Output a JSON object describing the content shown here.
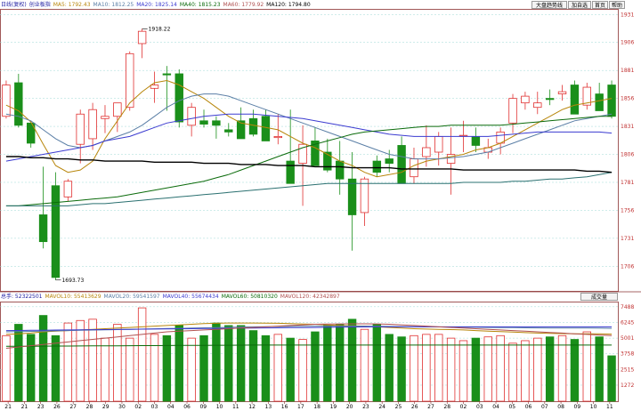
{
  "price_legend": [
    {
      "text": "日线(复权)",
      "color": "#1a1aa0"
    },
    {
      "text": "创业板指",
      "color": "#1a1aa0"
    },
    {
      "text": "MA5: 1792.43",
      "color": "#b8860b"
    },
    {
      "text": "MA10: 1812.25",
      "color": "#5b7fa6"
    },
    {
      "text": "MA20: 1825.14",
      "color": "#3b3bd0"
    },
    {
      "text": "MA40: 1815.23",
      "color": "#0b6b0b"
    },
    {
      "text": "MA60: 1779.92",
      "color": "#b05050"
    },
    {
      "text": "MA120: 1794.80",
      "color": "#000000"
    }
  ],
  "volume_legend": [
    {
      "text": "总手: 52322501",
      "color": "#1a1aa0"
    },
    {
      "text": "MAVOL10: 55413629",
      "color": "#b8860b"
    },
    {
      "text": "MAVOL20: 59541597",
      "color": "#5b7fa6"
    },
    {
      "text": "MAVOL40: 55674434",
      "color": "#3b3bd0"
    },
    {
      "text": "MAVOL60: 50810320",
      "color": "#0b6b0b"
    },
    {
      "text": "MAVOL120: 42342897",
      "color": "#b05050"
    }
  ],
  "toolbar": {
    "big_cap": "大盘趋势线",
    "add": "加自选",
    "home": "首页",
    "help": "帮助"
  },
  "volume_selector": "成交量",
  "chart_data": [
    {
      "type": "candlestick",
      "x": [
        "21",
        "21",
        "22",
        "23",
        "24",
        "26",
        "27",
        "28",
        "28",
        "29",
        "30",
        "30",
        "02",
        "03",
        "04",
        "05",
        "06",
        "07",
        "08",
        "09",
        "10",
        "11",
        "12",
        "13",
        "14",
        "15",
        "16",
        "17",
        "18",
        "19",
        "20",
        "21",
        "22",
        "23",
        "24",
        "25",
        "26",
        "27",
        "28",
        "01",
        "02",
        "03",
        "04",
        "05",
        "06",
        "07",
        "08",
        "09",
        "10",
        "11"
      ],
      "x_ticks": [
        "21",
        "21",
        "23",
        "26",
        "27",
        "28",
        "29",
        "30",
        "02",
        "03",
        "04",
        "06",
        "09",
        "10",
        "11",
        "12",
        "13",
        "16",
        "17",
        "18",
        "19",
        "20",
        "23",
        "24",
        "25",
        "26",
        "27",
        "28",
        "02",
        "03",
        "04",
        "05",
        "06",
        "07",
        "08",
        "09",
        "10",
        "11"
      ],
      "ohlc": [
        [
          1840,
          1872,
          1838,
          1868
        ],
        [
          1870,
          1878,
          1830,
          1832
        ],
        [
          1834,
          1836,
          1812,
          1816
        ],
        [
          1752,
          1795,
          1722,
          1728
        ],
        [
          1778,
          1790,
          1693.73,
          1696
        ],
        [
          1768,
          1784,
          1764,
          1782
        ],
        [
          1815,
          1846,
          1798,
          1842
        ],
        [
          1820,
          1852,
          1810,
          1846
        ],
        [
          1838,
          1850,
          1825,
          1840
        ],
        [
          1840,
          1850,
          1826,
          1852
        ],
        [
          1848,
          1898,
          1845,
          1896
        ],
        [
          1905,
          1918.22,
          1892,
          1916
        ],
        [
          1865,
          1880,
          1852,
          1868
        ],
        [
          1878,
          1885,
          1845,
          1877
        ],
        [
          1878,
          1882,
          1830,
          1835
        ],
        [
          1832,
          1852,
          1822,
          1848
        ],
        [
          1836,
          1846,
          1830,
          1833
        ],
        [
          1836,
          1840,
          1820,
          1832
        ],
        [
          1828,
          1834,
          1822,
          1826
        ],
        [
          1836,
          1848,
          1828,
          1820
        ],
        [
          1838,
          1846,
          1822,
          1824
        ],
        [
          1840,
          1846,
          1832,
          1818
        ],
        [
          1821,
          1842,
          1815,
          1822
        ],
        [
          1800,
          1846,
          1785,
          1780
        ],
        [
          1798,
          1832,
          1760,
          1815
        ],
        [
          1818,
          1830,
          1800,
          1796
        ],
        [
          1808,
          1820,
          1790,
          1792
        ],
        [
          1800,
          1818,
          1770,
          1784
        ],
        [
          1784,
          1808,
          1720,
          1752
        ],
        [
          1754,
          1786,
          1742,
          1784
        ],
        [
          1800,
          1805,
          1786,
          1790
        ],
        [
          1802,
          1810,
          1790,
          1798
        ],
        [
          1814,
          1822,
          1796,
          1780
        ],
        [
          1786,
          1812,
          1780,
          1802
        ],
        [
          1804,
          1832,
          1795,
          1812
        ],
        [
          1808,
          1826,
          1796,
          1822
        ],
        [
          1798,
          1830,
          1770,
          1806
        ],
        [
          1823,
          1836,
          1808,
          1823
        ],
        [
          1822,
          1830,
          1808,
          1814
        ],
        [
          1808,
          1820,
          1802,
          1812
        ],
        [
          1816,
          1830,
          1806,
          1826
        ],
        [
          1834,
          1860,
          1825,
          1856
        ],
        [
          1852,
          1862,
          1846,
          1858
        ],
        [
          1848,
          1862,
          1842,
          1852
        ],
        [
          1856,
          1864,
          1850,
          1855
        ],
        [
          1860,
          1868,
          1854,
          1862
        ],
        [
          1868,
          1872,
          1848,
          1842
        ],
        [
          1850,
          1870,
          1846,
          1866
        ],
        [
          1860,
          1870,
          1848,
          1845
        ],
        [
          1868,
          1872,
          1838,
          1840
        ]
      ],
      "annotations": [
        {
          "text": "1918.22",
          "value": 1918.22
        },
        {
          "text": "1693.73",
          "value": 1693.73
        }
      ],
      "y_ticks": [
        1931,
        1906,
        1881,
        1856,
        1831,
        1806,
        1781,
        1756,
        1731,
        1706
      ],
      "ylim": [
        1684,
        1936
      ],
      "moving_averages": [
        {
          "name": "MA5",
          "color": "#b8860b",
          "values": [
            1850,
            1845,
            1835,
            1815,
            1796,
            1790,
            1792,
            1800,
            1820,
            1836,
            1852,
            1862,
            1870,
            1872,
            1868,
            1862,
            1856,
            1848,
            1840,
            1834,
            1832,
            1830,
            1828,
            1822,
            1816,
            1812,
            1806,
            1800,
            1796,
            1790,
            1786,
            1788,
            1790,
            1796,
            1800,
            1802,
            1804,
            1806,
            1810,
            1812,
            1816,
            1822,
            1828,
            1834,
            1840,
            1846,
            1850,
            1852,
            1854,
            1856
          ]
        },
        {
          "name": "MA10",
          "color": "#5b7fa6",
          "values": [
            1842,
            1840,
            1836,
            1828,
            1820,
            1814,
            1812,
            1814,
            1818,
            1822,
            1826,
            1832,
            1840,
            1848,
            1854,
            1858,
            1860,
            1860,
            1858,
            1854,
            1850,
            1846,
            1842,
            1838,
            1834,
            1830,
            1826,
            1822,
            1818,
            1814,
            1810,
            1806,
            1804,
            1802,
            1802,
            1802,
            1803,
            1804,
            1806,
            1808,
            1812,
            1816,
            1820,
            1824,
            1828,
            1832,
            1836,
            1838,
            1840,
            1842
          ]
        },
        {
          "name": "MA20",
          "color": "#3b3bd0",
          "values": [
            1800,
            1802,
            1804,
            1806,
            1808,
            1810,
            1812,
            1814,
            1818,
            1820,
            1822,
            1826,
            1830,
            1834,
            1836,
            1838,
            1840,
            1841,
            1842,
            1842,
            1842,
            1841,
            1840,
            1839,
            1838,
            1836,
            1834,
            1832,
            1830,
            1828,
            1826,
            1824,
            1823,
            1822,
            1822,
            1822,
            1822,
            1822,
            1822,
            1822,
            1823,
            1824,
            1825,
            1826,
            1826,
            1826,
            1826,
            1826,
            1826,
            1825
          ]
        },
        {
          "name": "MA40",
          "color": "#0b6b0b",
          "values": [
            1760,
            1760,
            1761,
            1762,
            1763,
            1764,
            1765,
            1766,
            1767,
            1768,
            1770,
            1772,
            1774,
            1776,
            1778,
            1780,
            1782,
            1785,
            1788,
            1792,
            1796,
            1800,
            1804,
            1808,
            1812,
            1815,
            1818,
            1821,
            1824,
            1826,
            1827,
            1828,
            1829,
            1830,
            1831,
            1831,
            1832,
            1832,
            1832,
            1832,
            1832,
            1833,
            1834,
            1835,
            1836,
            1837,
            1838,
            1839,
            1840,
            1840
          ]
        },
        {
          "name": "MA60",
          "color": "#2a7070",
          "values": [
            1760,
            1760,
            1760,
            1760,
            1760,
            1760,
            1761,
            1762,
            1762,
            1763,
            1764,
            1765,
            1766,
            1767,
            1768,
            1769,
            1770,
            1771,
            1772,
            1773,
            1774,
            1775,
            1776,
            1777,
            1778,
            1779,
            1780,
            1780,
            1780,
            1780,
            1780,
            1780,
            1780,
            1780,
            1780,
            1780,
            1780,
            1781,
            1781,
            1781,
            1781,
            1782,
            1782,
            1783,
            1784,
            1784,
            1785,
            1786,
            1788,
            1790
          ]
        },
        {
          "name": "MA120",
          "color": "#000000",
          "values": [
            1804,
            1804,
            1803,
            1803,
            1802,
            1802,
            1801,
            1801,
            1800,
            1800,
            1800,
            1800,
            1799,
            1799,
            1799,
            1799,
            1798,
            1798,
            1798,
            1797,
            1797,
            1797,
            1796,
            1796,
            1796,
            1795,
            1795,
            1795,
            1794,
            1794,
            1794,
            1794,
            1793,
            1793,
            1793,
            1793,
            1793,
            1792,
            1792,
            1792,
            1792,
            1792,
            1792,
            1792,
            1792,
            1792,
            1792,
            1791,
            1791,
            1790
          ]
        }
      ]
    },
    {
      "type": "bar",
      "values": [
        5200,
        6100,
        5300,
        6800,
        5200,
        6200,
        6400,
        6500,
        5000,
        6100,
        5000,
        7400,
        5300,
        5200,
        6000,
        5000,
        5200,
        6200,
        6000,
        6000,
        5600,
        5200,
        5300,
        5000,
        4900,
        5500,
        6000,
        6100,
        6500,
        5700,
        6100,
        5300,
        5100,
        5200,
        5300,
        5300,
        5000,
        4800,
        5000,
        5100,
        5200,
        4600,
        4800,
        5000,
        5100,
        5200,
        4900,
        5500,
        5100,
        3600
      ],
      "y_ticks": [
        7488,
        6245,
        5001,
        3758,
        2515,
        1272
      ],
      "ylim": [
        0,
        7900
      ],
      "moving_averages": [
        {
          "name": "MAVOL10",
          "color": "#b8860b",
          "values": [
            5300,
            5350,
            5400,
            5500,
            5550,
            5600,
            5650,
            5700,
            5750,
            5800,
            5850,
            5900,
            5950,
            6000,
            6050,
            6100,
            6150,
            6180,
            6200,
            6200,
            6200,
            6190,
            6180,
            6150,
            6120,
            6100,
            6050,
            6000,
            5980,
            5950,
            5900,
            5850,
            5800,
            5750,
            5720,
            5700,
            5680,
            5650,
            5600,
            5560,
            5520,
            5480,
            5440,
            5400,
            5380,
            5360,
            5350,
            5350,
            5350,
            5320
          ]
        },
        {
          "name": "MAVOL20",
          "color": "#5b7fa6",
          "values": [
            5500,
            5520,
            5540,
            5560,
            5580,
            5600,
            5620,
            5640,
            5660,
            5680,
            5700,
            5720,
            5740,
            5760,
            5780,
            5800,
            5820,
            5840,
            5860,
            5880,
            5900,
            5910,
            5920,
            5930,
            5940,
            5950,
            5950,
            5950,
            5950,
            5950,
            5940,
            5930,
            5920,
            5910,
            5900,
            5890,
            5880,
            5870,
            5860,
            5850,
            5840,
            5830,
            5820,
            5810,
            5800,
            5800,
            5800,
            5800,
            5790,
            5780
          ]
        },
        {
          "name": "MAVOL40",
          "color": "#3b3bd0",
          "values": [
            5600,
            5610,
            5620,
            5630,
            5640,
            5650,
            5660,
            5670,
            5680,
            5690,
            5700,
            5710,
            5720,
            5730,
            5740,
            5750,
            5760,
            5770,
            5780,
            5790,
            5800,
            5810,
            5820,
            5830,
            5840,
            5850,
            5860,
            5870,
            5880,
            5890,
            5900,
            5900,
            5900,
            5900,
            5900,
            5900,
            5900,
            5900,
            5900,
            5900,
            5900,
            5900,
            5900,
            5900,
            5900,
            5900,
            5900,
            5900,
            5900,
            5900
          ]
        },
        {
          "name": "MAVOL60",
          "color": "#0b6b0b",
          "values": [
            4350,
            4355,
            4360,
            4365,
            4370,
            4375,
            4380,
            4385,
            4390,
            4395,
            4400,
            4405,
            4410,
            4415,
            4420,
            4425,
            4430,
            4435,
            4440,
            4445,
            4450,
            4450,
            4450,
            4450,
            4450,
            4450,
            4450,
            4450,
            4450,
            4450,
            4450,
            4450,
            4450,
            4450,
            4450,
            4450,
            4450,
            4450,
            4450,
            4450,
            4450,
            4450,
            4450,
            4450,
            4450,
            4450,
            4450,
            4450,
            4450,
            4450
          ]
        },
        {
          "name": "MAVOL120",
          "color": "#b05050",
          "values": [
            4200,
            4300,
            4400,
            4500,
            4600,
            4700,
            4800,
            4900,
            5000,
            5100,
            5200,
            5300,
            5400,
            5500,
            5550,
            5600,
            5650,
            5700,
            5750,
            5800,
            5850,
            5900,
            5950,
            6000,
            6050,
            6100,
            6120,
            6130,
            6140,
            6140,
            6130,
            6100,
            6050,
            6000,
            5950,
            5900,
            5850,
            5800,
            5750,
            5700,
            5650,
            5600,
            5550,
            5500,
            5450,
            5400,
            5350,
            5300,
            5250,
            5200
          ]
        }
      ]
    }
  ]
}
